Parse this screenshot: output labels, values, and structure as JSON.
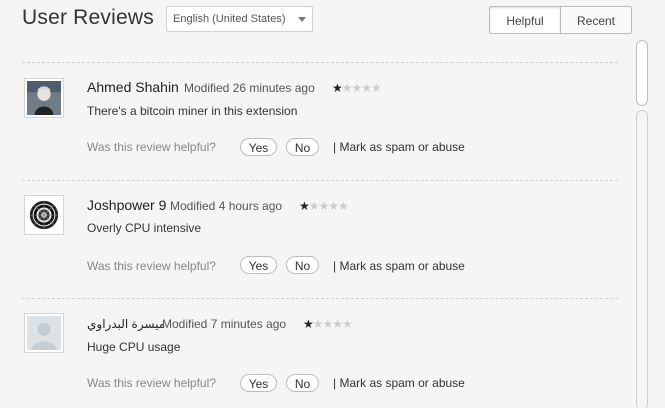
{
  "header": {
    "title": "User Reviews",
    "language": "English (United States)",
    "sort": {
      "helpful": "Helpful",
      "recent": "Recent",
      "active": "Helpful"
    }
  },
  "common": {
    "helpful_question": "Was this review helpful?",
    "yes": "Yes",
    "no": "No",
    "spam": "| Mark as spam or abuse"
  },
  "reviews": [
    {
      "author": "Ahmed Shahin",
      "modified": "Modified 26 minutes ago",
      "rating": 1,
      "rating_max": 5,
      "text": "There's a bitcoin miner in this extension",
      "avatar": "photo-avatar"
    },
    {
      "author": "Joshpower 9",
      "modified": "Modified 4 hours ago",
      "rating": 1,
      "rating_max": 5,
      "text": "Overly CPU intensive",
      "avatar": "mandala-avatar"
    },
    {
      "author": "ميسرة البدراوي",
      "modified": "Modified 7 minutes ago",
      "rating": 1,
      "rating_max": 5,
      "text": "Huge CPU usage",
      "avatar": "default-avatar"
    }
  ],
  "colors": {
    "background": "#f5f5f5",
    "star_on": "#222222",
    "star_off": "#cccccc"
  }
}
